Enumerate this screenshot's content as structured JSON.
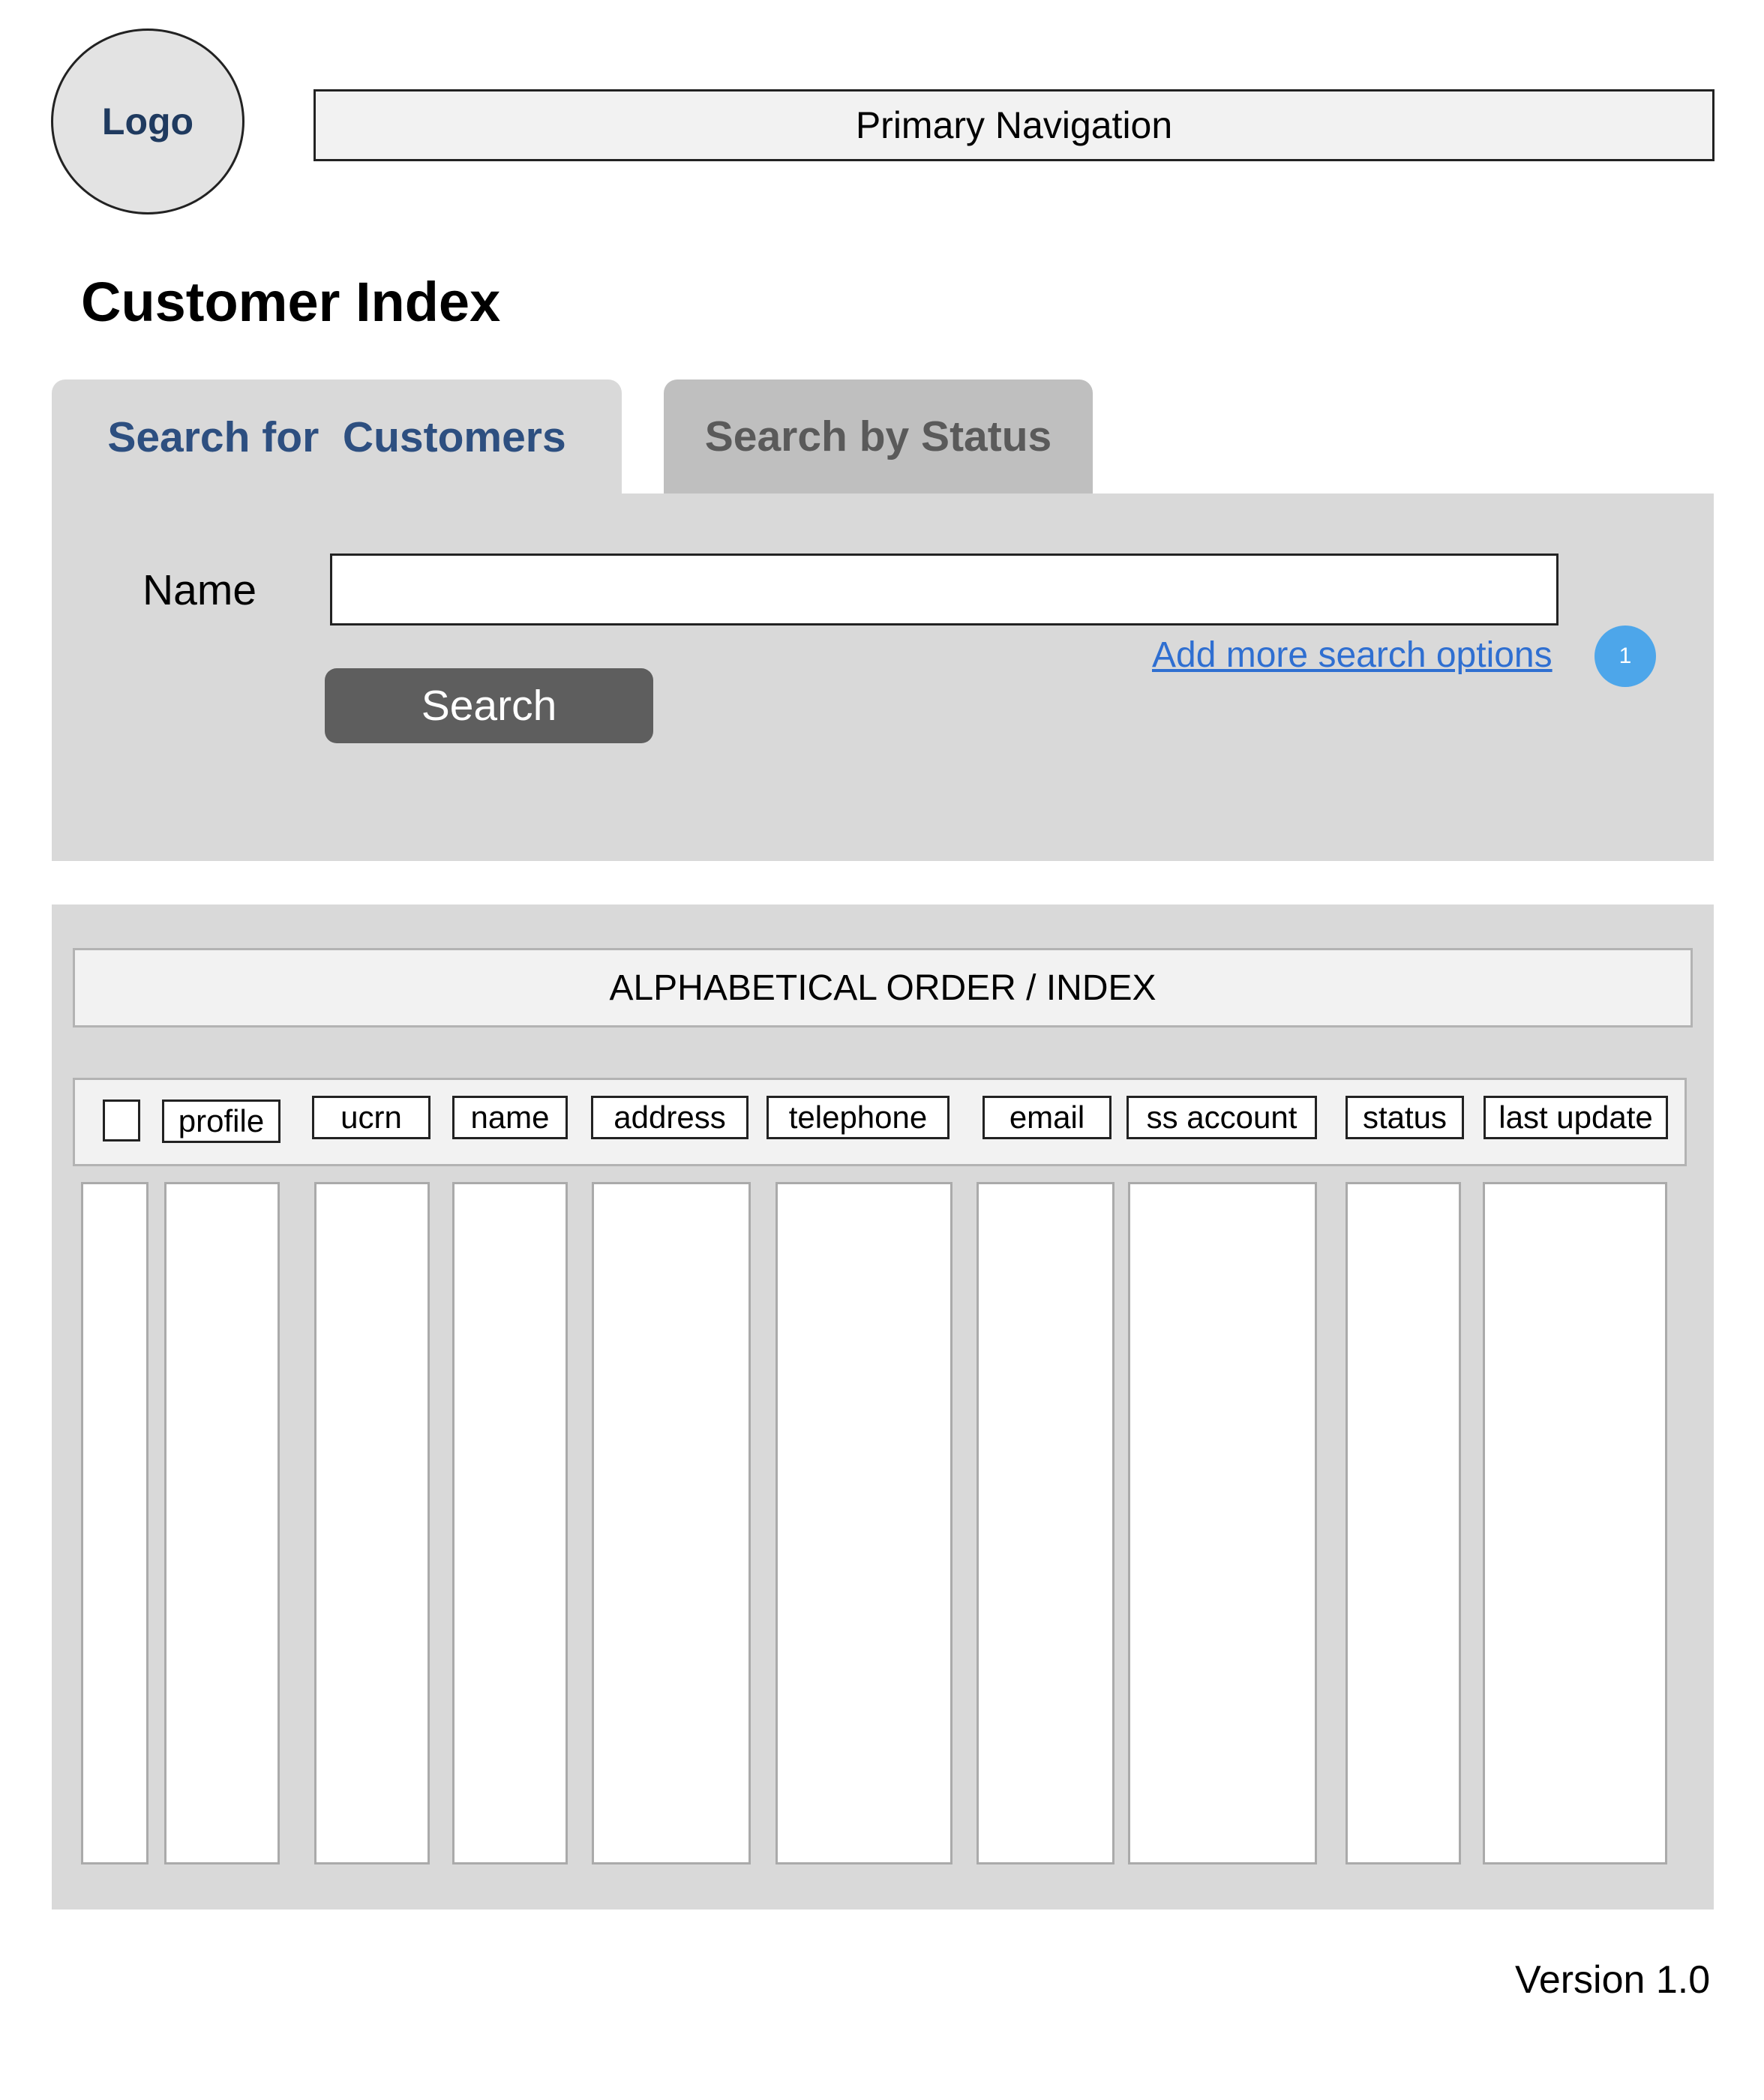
{
  "header": {
    "logo_label": "Logo",
    "primary_nav_label": "Primary Navigation"
  },
  "page": {
    "title": "Customer Index",
    "version": "Version 1.0"
  },
  "tabs": [
    {
      "label": "Search for  Customers",
      "active": true
    },
    {
      "label": "Search by Status",
      "active": false
    }
  ],
  "search": {
    "name_label": "Name",
    "name_value": "",
    "button_label": "Search",
    "more_options_link": "Add more search options",
    "annotation_badge": "1"
  },
  "results": {
    "index_bar_label": "ALPHABETICAL ORDER / INDEX",
    "columns": [
      "profile",
      "ucrn",
      "name",
      "address",
      "telephone",
      "email",
      "ss account",
      "status",
      "last update"
    ]
  },
  "colors": {
    "panel_bg": "#d9d9d9",
    "active_tab_text": "#2d4f80",
    "inactive_tab_bg": "#bfbfbf",
    "button_bg": "#5e5e5e",
    "link": "#2f6fd1",
    "badge": "#4da6ea"
  }
}
